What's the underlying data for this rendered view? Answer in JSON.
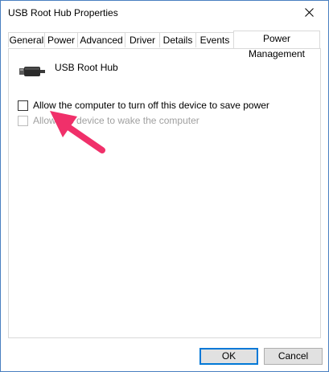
{
  "window": {
    "title": "USB Root Hub Properties"
  },
  "tabs": [
    {
      "label": "General"
    },
    {
      "label": "Power"
    },
    {
      "label": "Advanced"
    },
    {
      "label": "Driver"
    },
    {
      "label": "Details"
    },
    {
      "label": "Events"
    },
    {
      "label": "Power Management",
      "active": true
    }
  ],
  "device": {
    "name": "USB Root Hub",
    "icon": "usb-plug-icon"
  },
  "options": {
    "allow_turn_off": {
      "label": "Allow the computer to turn off this device to save power",
      "checked": false,
      "enabled": true
    },
    "allow_wake": {
      "label": "Allow this device to wake the computer",
      "checked": false,
      "enabled": false
    }
  },
  "buttons": {
    "ok": "OK",
    "cancel": "Cancel"
  },
  "colors": {
    "annotation_arrow": "#f0306a",
    "accent": "#0078d7"
  }
}
